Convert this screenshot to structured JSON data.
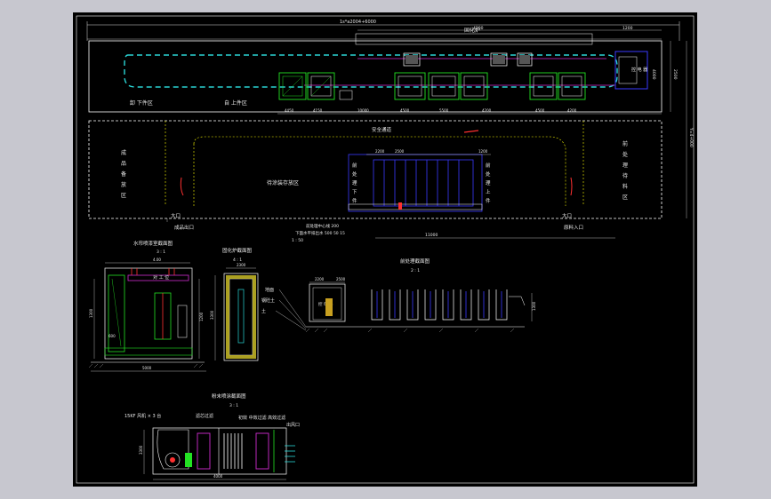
{
  "colors": {
    "background": "#000000",
    "frame": "#ffffff",
    "outline": "#ffffff",
    "dim": "#dcdcdc",
    "equipment": "#23e223",
    "conveyor": "#2ad6d6",
    "pipe": "#c020c0",
    "blue": "#3a3aff",
    "yellow": "#ffff00",
    "red": "#ff3030",
    "magenta": "#d02dd0"
  },
  "plan": {
    "overall_dim": "1s*a2004+6000",
    "dim_4200": "4200",
    "dim_1200": "1200",
    "solidify_furnace": "固化炉",
    "label_unload_zone": "卸 下件区",
    "label_load_zone": "自 上件区",
    "label_control": "控 电 器",
    "label_gauge": "4000",
    "seg_dims": [
      "4450",
      "4150",
      "10000",
      "4500",
      "5500",
      "4200",
      "4500",
      "4200"
    ],
    "right_dim": "2500",
    "right_dim2": "1200",
    "aisle": "安全通道",
    "left_zone": "成品备放区",
    "right_zone": "前处理待料区",
    "center_zone": "待涂装存放区",
    "pretreat_unload": "前处理下件区",
    "pretreat_load": "前处理上件区",
    "pretreat_dims": [
      "2200",
      "2500",
      "1200"
    ],
    "pretreat_bottom_dim": "11000",
    "exit": "大口",
    "exit_label": "成品出口",
    "entrance": "大口",
    "entrance_label": "原料入口",
    "note_1": "前处理中心线 200",
    "note_2": "下面水平排出水 500  50  15",
    "note_3": "1 : 50",
    "height_note": "Y=4+000"
  },
  "section_paint": {
    "title": "水帘喷漆室截面图",
    "scale": "3 : 1",
    "dim_top": "4.00",
    "pump_label": "对 工 位",
    "dim_left": "1300",
    "dim_mid": "600",
    "dim_right": "1200",
    "dim_bottom": "5000",
    "label_filter": "水帘过滤室",
    "label_pump": "水泵"
  },
  "section_oven": {
    "title": "固化炉截面图",
    "scale": "4 : 1",
    "dim_top": "2300",
    "dim_left": "3300"
  },
  "section_pretreat": {
    "title": "前处理截面图",
    "scale": "2 : 1",
    "legend": [
      "地面",
      "钢砼土",
      "土"
    ],
    "dims": [
      "2200",
      "2500"
    ],
    "tank_label": "控 电 器",
    "right_dim": "1300"
  },
  "section_spray": {
    "title": "粉末喷涂截面图",
    "scale": "3 : 1",
    "label_fan": "15KF 风机 × 3 台",
    "label_filter": "滤芯过滤",
    "label_primary": "初效  中效过滤  高效过滤",
    "label_outlet": "出风口",
    "dim_left": "3300",
    "dim_bottom": "4000"
  }
}
